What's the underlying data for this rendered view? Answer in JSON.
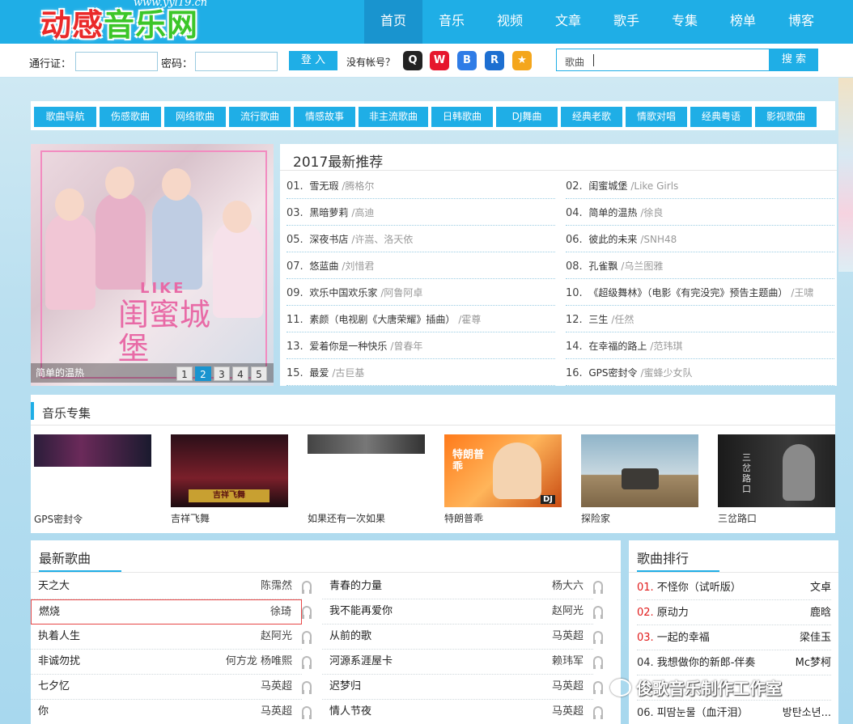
{
  "header": {
    "logo_part1": "动感",
    "logo_part2": "音乐网",
    "logo_url": "www.yyl19.cn",
    "nav": [
      {
        "label": "首页",
        "active": true
      },
      {
        "label": "音乐"
      },
      {
        "label": "视频"
      },
      {
        "label": "文章"
      },
      {
        "label": "歌手"
      },
      {
        "label": "专集"
      },
      {
        "label": "榜单"
      },
      {
        "label": "博客"
      }
    ],
    "colors": {
      "primary": "#1faee6",
      "active": "#1994cf"
    }
  },
  "loginbar": {
    "account_label": "通行证：",
    "password_label": "密码：",
    "login_button": "登 入",
    "no_account": "没有帐号？",
    "social_icons": [
      "qq-icon",
      "weibo-icon",
      "baidu-icon",
      "renren-icon",
      "star-icon"
    ],
    "search_placeholder": "歌曲",
    "search_button": "搜 索"
  },
  "categories": [
    "歌曲导航",
    "伤感歌曲",
    "网络歌曲",
    "流行歌曲",
    "情感故事",
    "非主流歌曲",
    "日韩歌曲",
    "DJ舞曲",
    "经典老歌",
    "情歌对唱",
    "经典粤语",
    "影视歌曲"
  ],
  "hero": {
    "like_text": "LIKE",
    "title_art": "闺蜜城堡",
    "caption": "简单的温热",
    "pages": [
      "1",
      "2",
      "3",
      "4",
      "5"
    ],
    "active_page": 2
  },
  "recommend": {
    "title": "2017最新推荐",
    "items": [
      {
        "num": "01.",
        "song": "雪无瑕",
        "artist": "/腾格尔"
      },
      {
        "num": "02.",
        "song": "闺蜜城堡",
        "artist": "/Like Girls"
      },
      {
        "num": "03.",
        "song": "黑暗萝莉",
        "artist": "/高迪"
      },
      {
        "num": "04.",
        "song": "简单的温热",
        "artist": "/徐良"
      },
      {
        "num": "05.",
        "song": "深夜书店",
        "artist": "/许嵩、洛天依"
      },
      {
        "num": "06.",
        "song": "彼此的未来",
        "artist": "/SNH48"
      },
      {
        "num": "07.",
        "song": "悠蓝曲",
        "artist": "/刘惜君"
      },
      {
        "num": "08.",
        "song": "孔雀飘",
        "artist": "/乌兰图雅"
      },
      {
        "num": "09.",
        "song": "欢乐中国欢乐家",
        "artist": "/阿鲁阿卓"
      },
      {
        "num": "10.",
        "song": "《超级舞林》（电影《有完没完》预告主题曲）",
        "artist": "/王啸"
      },
      {
        "num": "11.",
        "song": "素颜（电视剧《大唐荣耀》插曲）",
        "artist": "/霍尊"
      },
      {
        "num": "12.",
        "song": "三生",
        "artist": "/任然"
      },
      {
        "num": "13.",
        "song": "爱着你是一种快乐",
        "artist": "/曾春年"
      },
      {
        "num": "14.",
        "song": "在幸福的路上",
        "artist": "/范玮琪"
      },
      {
        "num": "15.",
        "song": "最爱",
        "artist": "/古巨基"
      },
      {
        "num": "16.",
        "song": "GPS密封令",
        "artist": "/蜜蜂少女队"
      }
    ]
  },
  "albums": {
    "title": "音乐专集",
    "items": [
      {
        "name": "GPS密封令"
      },
      {
        "name": "吉祥飞舞"
      },
      {
        "name": "如果还有一次如果"
      },
      {
        "name": "特朗普乖"
      },
      {
        "name": "探险家"
      },
      {
        "name": "三岔路口"
      }
    ],
    "cover_text": {
      "item4": "特朗普乖",
      "item4_badge": "DJ",
      "item2_banner": "吉祥飞舞",
      "item6": "三岔路口"
    }
  },
  "newest": {
    "title": "最新歌曲",
    "left": [
      {
        "song": "天之大",
        "artist": "陈霈然"
      },
      {
        "song": "燃烧",
        "artist": "徐琦"
      },
      {
        "song": "执着人生",
        "artist": "赵阿光"
      },
      {
        "song": "非诚勿扰",
        "artist": "何方龙 杨唯熙"
      },
      {
        "song": "七夕忆",
        "artist": "马英超"
      },
      {
        "song": "你",
        "artist": "马英超"
      }
    ],
    "right": [
      {
        "song": "青春的力量",
        "artist": "杨大六"
      },
      {
        "song": "我不能再爱你",
        "artist": "赵阿光"
      },
      {
        "song": "从前的歌",
        "artist": "马英超"
      },
      {
        "song": "河源系涯屋卡",
        "artist": "赖玮军"
      },
      {
        "song": "迟梦归",
        "artist": "马英超"
      },
      {
        "song": "情人节夜",
        "artist": "马英超"
      }
    ]
  },
  "ranking": {
    "title": "歌曲排行",
    "items": [
      {
        "num": "01.",
        "song": "不怪你（试听版）",
        "artist": "文卓",
        "top": true
      },
      {
        "num": "02.",
        "song": "原动力",
        "artist": "鹿晗",
        "top": true
      },
      {
        "num": "03.",
        "song": "一起的幸福",
        "artist": "梁佳玉",
        "top": true
      },
      {
        "num": "04.",
        "song": "我想做你的新郎-伴奏",
        "artist": "Mc梦柯",
        "top": false
      },
      {
        "num": "05.",
        "song": "",
        "artist": "",
        "top": false
      },
      {
        "num": "06.",
        "song": "피땀눈물（血汗泪）",
        "artist": "방탄소년...",
        "top": false
      }
    ]
  },
  "watermark": "俊歌音乐制作工作室"
}
